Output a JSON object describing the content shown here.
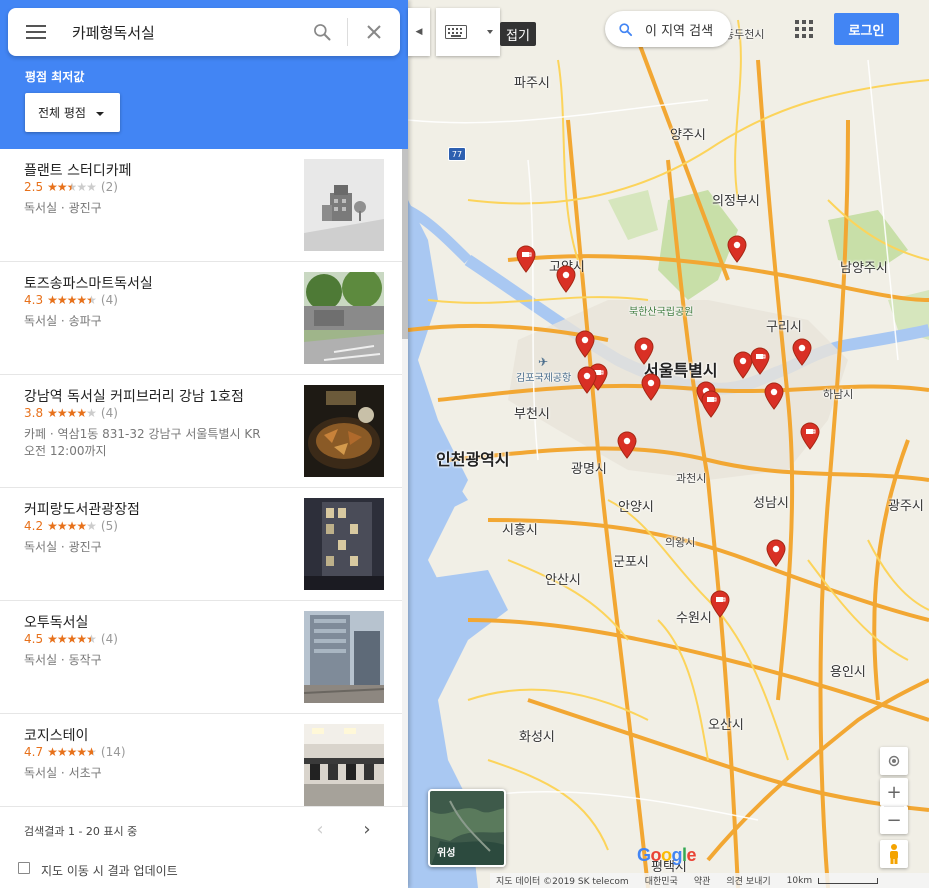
{
  "search": {
    "query": "카페형독서실"
  },
  "filter": {
    "title": "평점 최저값",
    "dropdown_label": "전체 평점"
  },
  "results": [
    {
      "title": "플랜트 스터디카페",
      "score": "2.5",
      "stars_on": "★★",
      "stars_half": "★",
      "stars_off": "★★",
      "count": "(2)",
      "line1": "독서실 · 광진구",
      "line2": ""
    },
    {
      "title": "토즈송파스마트독서실",
      "score": "4.3",
      "stars_on": "★★★★",
      "stars_half": "★",
      "stars_off": "",
      "count": "(4)",
      "line1": "독서실 · 송파구",
      "line2": ""
    },
    {
      "title": "강남역 독서실 커피브러리 강남 1호점",
      "score": "3.8",
      "stars_on": "★★★★",
      "stars_half": "",
      "stars_off": "★",
      "count": "(4)",
      "line1": "카페 · 역삼1동 831-32 강남구 서울특별시 KR",
      "line2": "오전 12:00까지"
    },
    {
      "title": "커피랑도서관광장점",
      "score": "4.2",
      "stars_on": "★★★★",
      "stars_half": "",
      "stars_off": "★",
      "count": "(5)",
      "line1": "독서실 · 광진구",
      "line2": ""
    },
    {
      "title": "오투독서실",
      "score": "4.5",
      "stars_on": "★★★★",
      "stars_half": "★",
      "stars_off": "",
      "count": "(4)",
      "line1": "독서실 · 동작구",
      "line2": ""
    },
    {
      "title": "코지스테이",
      "score": "4.7",
      "stars_on": "★★★★",
      "stars_half": "★",
      "stars_off": "",
      "count": "(14)",
      "line1": "독서실 · 서초구",
      "line2": ""
    }
  ],
  "footer": {
    "pager_text": "검색결과 1 - 20 표시 중",
    "update_label": "지도 이동 시 결과 업데이트"
  },
  "map": {
    "collapse_tip": "접기",
    "area_search": "이 지역 검색",
    "login": "로그인",
    "satellite_label": "위성",
    "google": "Google",
    "attribution": [
      "지도 데이터 ©2019 SK telecom",
      "대한민국",
      "약관",
      "의견 보내기",
      "10km"
    ],
    "places": {
      "paju": "파주시",
      "dongducheon": "동두천시",
      "yangju": "양주시",
      "uijeongbu": "의정부시",
      "goyang": "고양시",
      "namyangju": "남양주시",
      "bukhansan": "북한산국립공원",
      "guri": "구리시",
      "seoul": "서울특별시",
      "gimpo_airport": "김포국제공항",
      "bucheon": "부천시",
      "hanam": "하남시",
      "incheon": "인천광역시",
      "gwangmyeong": "광명시",
      "gwacheon": "과천시",
      "seongnam": "성남시",
      "gwangju": "광주시",
      "anyang": "안양시",
      "siheung": "시흥시",
      "uiwang": "의왕시",
      "gunpo": "군포시",
      "ansan": "안산시",
      "suwon": "수원시",
      "yongin": "용인시",
      "osan": "오산시",
      "hwaseong": "화성시",
      "pyeongtaek": "평택시"
    }
  }
}
